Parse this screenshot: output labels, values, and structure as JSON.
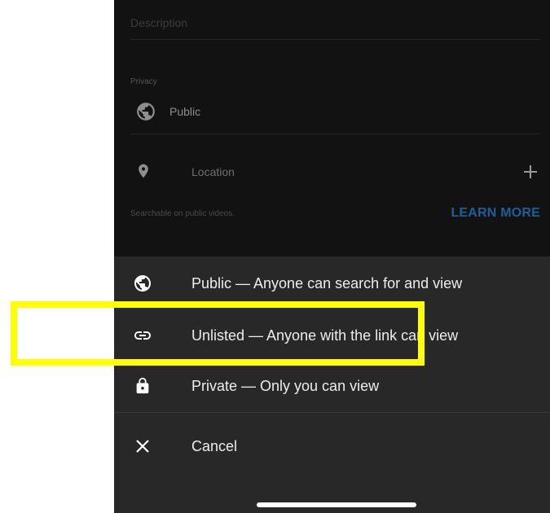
{
  "form": {
    "description_placeholder": "Description",
    "privacy_label": "Privacy",
    "privacy_value": "Public",
    "location_label": "Location",
    "searchable_note": "Searchable on public videos.",
    "learn_more": "LEARN MORE"
  },
  "sheet": {
    "options": [
      {
        "label": "Public — Anyone can search for and view",
        "icon": "globe-icon"
      },
      {
        "label": "Unlisted — Anyone with the link can view",
        "icon": "link-icon"
      },
      {
        "label": "Private — Only you can view",
        "icon": "lock-icon"
      }
    ],
    "cancel": {
      "label": "Cancel",
      "icon": "close-icon"
    }
  },
  "annotation": {
    "color": "#ffff00",
    "target": "unlisted-option"
  },
  "colors": {
    "sheet_background": "#282828",
    "form_background": "#121212",
    "accent": "#1d5f9a"
  }
}
